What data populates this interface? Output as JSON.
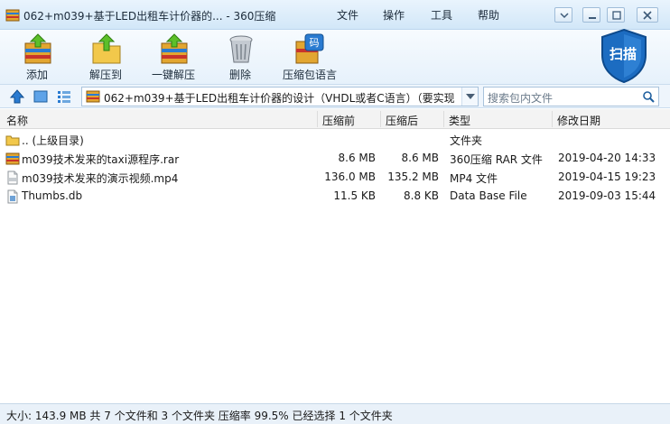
{
  "window": {
    "title": "062+m039+基于LED出租车计价器的... - 360压缩",
    "menu": [
      "文件",
      "操作",
      "工具",
      "帮助"
    ]
  },
  "toolbar": {
    "buttons": [
      {
        "label": "添加",
        "icon": "add-archive-icon"
      },
      {
        "label": "解压到",
        "icon": "extract-to-icon"
      },
      {
        "label": "一键解压",
        "icon": "one-click-extract-icon"
      },
      {
        "label": "删除",
        "icon": "trash-icon"
      },
      {
        "label": "压缩包语言",
        "icon": "archive-language-icon"
      }
    ],
    "scan_label": "扫描",
    "lang_glyph": "码"
  },
  "address": {
    "path": "062+m039+基于LED出租车计价器的设计（VHDL或者C语言）（要实现",
    "search_placeholder": "搜索包内文件"
  },
  "columns": [
    "名称",
    "压缩前",
    "压缩后",
    "类型",
    "修改日期"
  ],
  "files": [
    {
      "name": ".. (上级目录)",
      "before": "",
      "after": "",
      "type": "文件夹",
      "date": "",
      "icon": "folder-icon"
    },
    {
      "name": "m039技术发来的taxi源程序.rar",
      "before": "8.6 MB",
      "after": "8.6 MB",
      "type": "360压缩 RAR 文件",
      "date": "2019-04-20 14:33",
      "icon": "rar-file-icon"
    },
    {
      "name": "m039技术发来的演示视频.mp4",
      "before": "136.0 MB",
      "after": "135.2 MB",
      "type": "MP4 文件",
      "date": "2019-04-15 19:23",
      "icon": "mp4-file-icon"
    },
    {
      "name": "Thumbs.db",
      "before": "11.5 KB",
      "after": "8.8 KB",
      "type": "Data Base File",
      "date": "2019-09-03 15:44",
      "icon": "db-file-icon"
    }
  ],
  "status": "大小: 143.9 MB 共 7 个文件和 3 个文件夹 压缩率 99.5% 已经选择 1 个文件夹",
  "colors": {
    "accent": "#1f6fc5",
    "titlebar": "#d2e7f8",
    "shield": "#1c6cc1"
  }
}
